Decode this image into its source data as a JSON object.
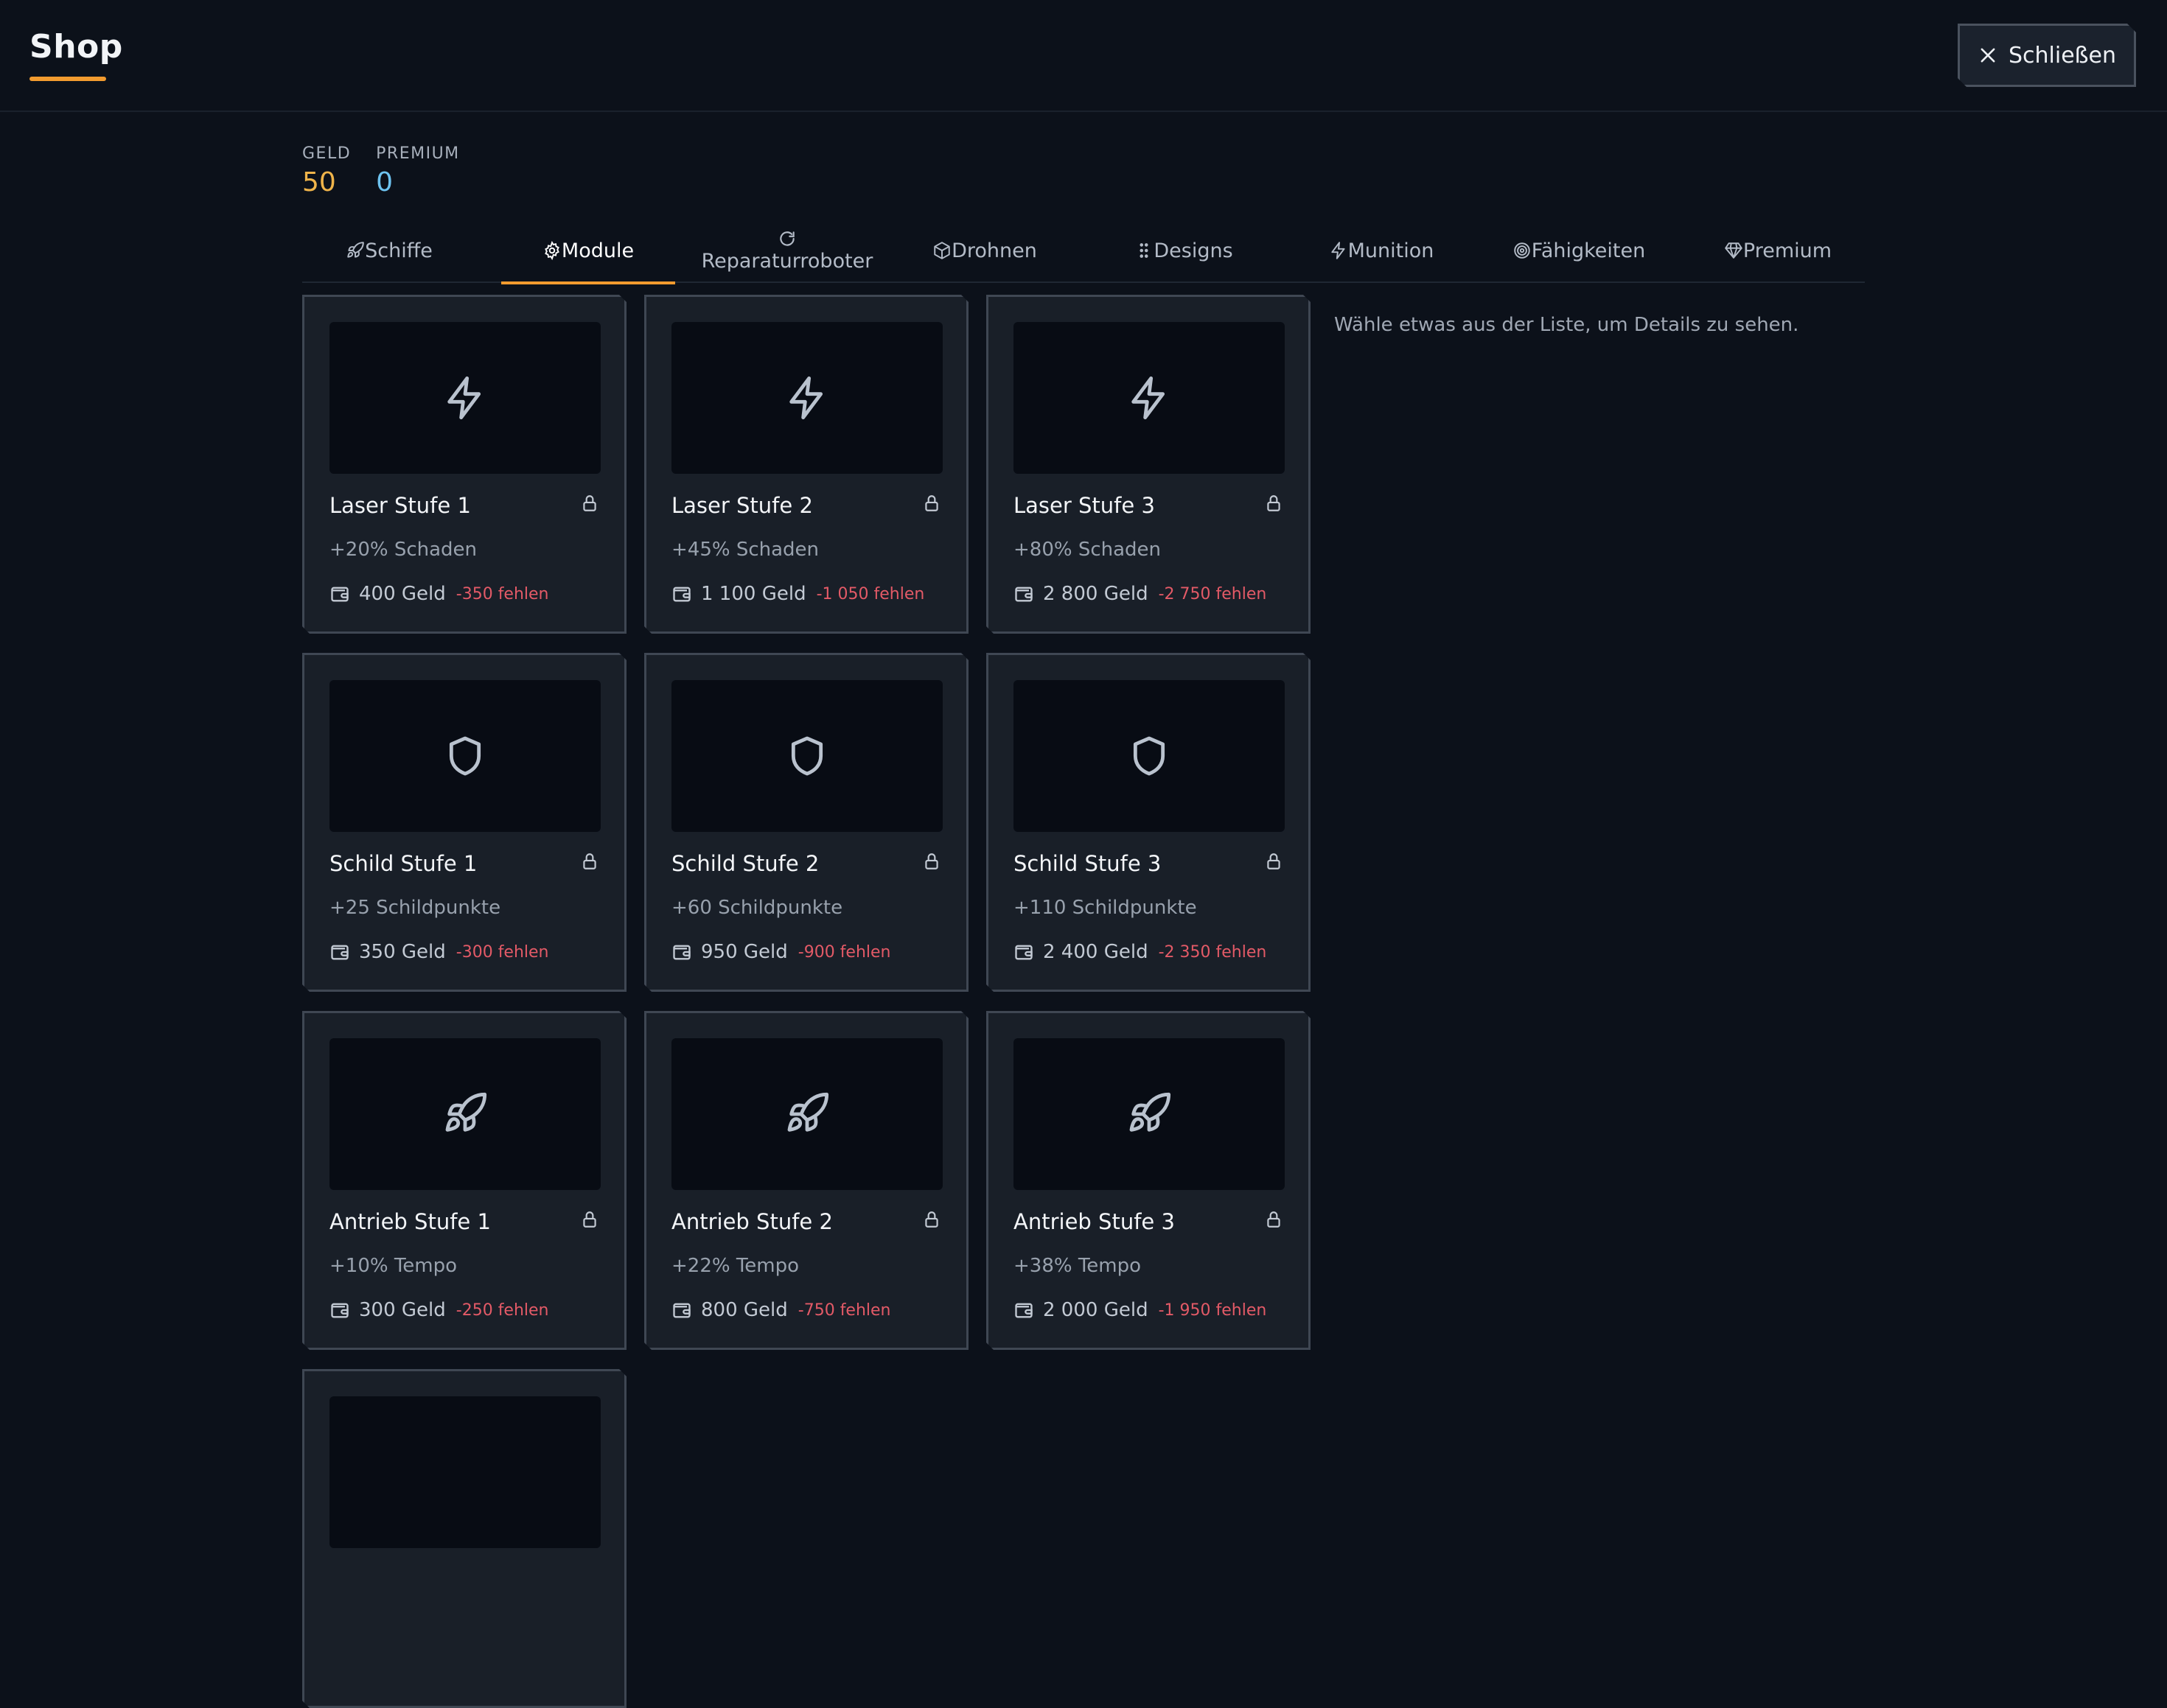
{
  "header": {
    "title": "Shop",
    "close_label": "Schließen"
  },
  "wallet": {
    "geld_label": "GELD",
    "geld_value": "50",
    "premium_label": "PREMIUM",
    "premium_value": "0"
  },
  "tabs": [
    {
      "label": "Schiffe",
      "icon": "rocket-icon"
    },
    {
      "label": "Module",
      "icon": "gear-icon",
      "active": true
    },
    {
      "label": "Reparaturroboter",
      "icon": "refresh-icon"
    },
    {
      "label": "Drohnen",
      "icon": "box-icon"
    },
    {
      "label": "Designs",
      "icon": "dots-icon"
    },
    {
      "label": "Munition",
      "icon": "lightning-icon"
    },
    {
      "label": "Fähigkeiten",
      "icon": "target-icon"
    },
    {
      "label": "Premium",
      "icon": "diamond-icon"
    }
  ],
  "items": [
    {
      "name": "Laser Stufe 1",
      "effect": "+20% Schaden",
      "price": "400 Geld",
      "missing": "-350 fehlen",
      "icon": "lightning-icon"
    },
    {
      "name": "Laser Stufe 2",
      "effect": "+45% Schaden",
      "price": "1 100 Geld",
      "missing": "-1 050 fehlen",
      "icon": "lightning-icon"
    },
    {
      "name": "Laser Stufe 3",
      "effect": "+80% Schaden",
      "price": "2 800 Geld",
      "missing": "-2 750 fehlen",
      "icon": "lightning-icon"
    },
    {
      "name": "Schild Stufe 1",
      "effect": "+25 Schildpunkte",
      "price": "350 Geld",
      "missing": "-300 fehlen",
      "icon": "shield-icon"
    },
    {
      "name": "Schild Stufe 2",
      "effect": "+60 Schildpunkte",
      "price": "950 Geld",
      "missing": "-900 fehlen",
      "icon": "shield-icon"
    },
    {
      "name": "Schild Stufe 3",
      "effect": "+110 Schildpunkte",
      "price": "2 400 Geld",
      "missing": "-2 350 fehlen",
      "icon": "shield-icon"
    },
    {
      "name": "Antrieb Stufe 1",
      "effect": "+10% Tempo",
      "price": "300 Geld",
      "missing": "-250 fehlen",
      "icon": "rocket-icon"
    },
    {
      "name": "Antrieb Stufe 2",
      "effect": "+22% Tempo",
      "price": "800 Geld",
      "missing": "-750 fehlen",
      "icon": "rocket-icon"
    },
    {
      "name": "Antrieb Stufe 3",
      "effect": "+38% Tempo",
      "price": "2 000 Geld",
      "missing": "-1 950 fehlen",
      "icon": "rocket-icon"
    }
  ],
  "details": {
    "hint": "Wähle etwas aus der Liste, um Details zu sehen."
  },
  "colors": {
    "accent": "#f29b2f",
    "geld": "#f0b44a",
    "premium": "#6ec3f0",
    "missing": "#e35a67"
  }
}
